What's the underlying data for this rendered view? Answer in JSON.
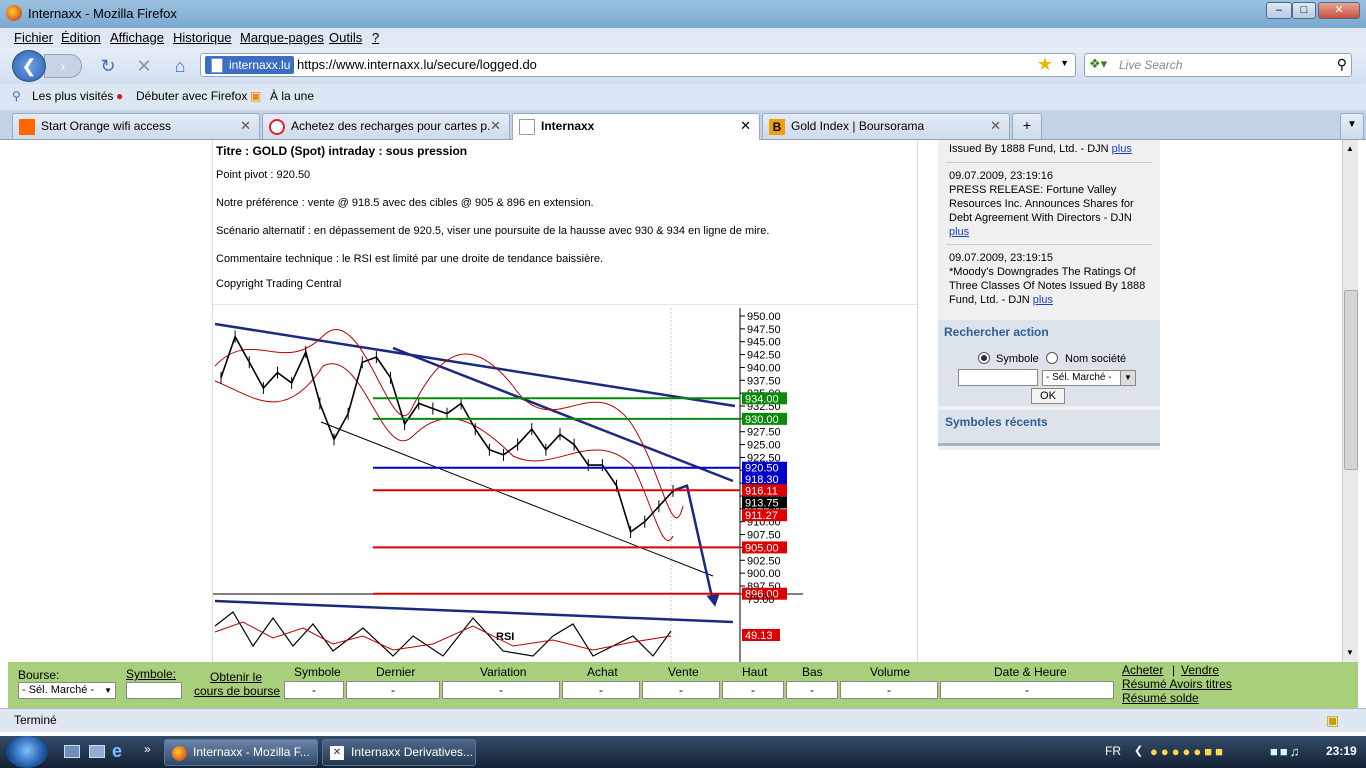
{
  "window": {
    "title": "Internaxx - Mozilla Firefox"
  },
  "menu": [
    "Fichier",
    "Édition",
    "Affichage",
    "Historique",
    "Marque-pages",
    "Outils",
    "?"
  ],
  "nav": {
    "site": "internaxx.lu",
    "url": "https://www.internaxx.lu/secure/logged.do",
    "search_placeholder": "Live Search"
  },
  "bookmarks": [
    "Les plus visités",
    "Débuter avec Firefox",
    "À la une"
  ],
  "tabs": [
    {
      "label": "Start Orange wifi access",
      "color": "#ff6600"
    },
    {
      "label": "Achetez des recharges pour cartes p...",
      "color": "#d22"
    },
    {
      "label": "Internaxx",
      "color": "#999"
    },
    {
      "label": "Gold Index | Boursorama",
      "color": "#f0a000"
    }
  ],
  "article": {
    "title": "Titre : GOLD (Spot) intraday : sous pression",
    "pivot": "Point pivot : 920.50",
    "preference": "Notre préférence : vente @ 918.5 avec des cibles @ 905 & 896 en extension.",
    "scenario": "Scénario alternatif : en dépassement de 920.5, viser une poursuite de la hausse avec 930 & 934 en ligne de mire.",
    "comment": "Commentaire technique : le RSI est limité par une droite de tendance baissière.",
    "copyright": "Copyright Trading Central"
  },
  "chart_data": {
    "type": "line",
    "title": "",
    "ylim": [
      897.5,
      950
    ],
    "y_ticks": [
      "950.00",
      "947.50",
      "945.00",
      "942.50",
      "940.00",
      "937.50",
      "935.00",
      "932.50",
      "930.00",
      "927.50",
      "925.00",
      "922.50",
      "920.00",
      "917.50",
      "915.00",
      "912.50",
      "910.00",
      "907.50",
      "905.00",
      "902.50",
      "900.00",
      "897.50"
    ],
    "levels": [
      {
        "label": "934.00",
        "value": 934.0,
        "color": "#0a8a0a"
      },
      {
        "label": "930.00",
        "value": 930.0,
        "color": "#0a8a0a"
      },
      {
        "label": "920.50",
        "value": 920.5,
        "color": "#0000cc"
      },
      {
        "label": "918.30",
        "value": 918.3,
        "color": "#0000cc"
      },
      {
        "label": "916.11",
        "value": 916.11,
        "color": "#dd0000"
      },
      {
        "label": "913.75",
        "value": 913.75,
        "color": "#000000"
      },
      {
        "label": "911.27",
        "value": 911.27,
        "color": "#dd0000"
      },
      {
        "label": "905.00",
        "value": 905.0,
        "color": "#dd0000"
      },
      {
        "label": "896.00",
        "value": 896.0,
        "color": "#dd0000"
      }
    ],
    "price": [
      938,
      946,
      941,
      936,
      939,
      937,
      943,
      933,
      926,
      931,
      941,
      942,
      938,
      929,
      933,
      932,
      931,
      933,
      928,
      924,
      923,
      925,
      928,
      924,
      927,
      925,
      921,
      921,
      917,
      908,
      910,
      913,
      916
    ],
    "rsi_label": "RSI",
    "rsi_top": "75.00",
    "rsi_value": "49.13"
  },
  "news": [
    {
      "text": "Issued By 1888 Fund, Ltd. -  DJN",
      "link": "plus"
    },
    {
      "date": "09.07.2009, 23:19:16",
      "text": "PRESS RELEASE: Fortune Valley Resources Inc. Announces Shares for Debt Agreement With Directors -  DJN",
      "link": "plus"
    },
    {
      "date": "09.07.2009, 23:19:15",
      "text": "*Moody's Downgrades The Ratings Of Three Classes Of Notes Issued By 1888 Fund, Ltd. -  DJN",
      "link": "plus"
    }
  ],
  "search_action": {
    "title": "Rechercher action",
    "opt1": "Symbole",
    "opt2": "Nom société",
    "market": "- Sél. Marché -",
    "ok": "OK"
  },
  "recent": {
    "title": "Symboles récents"
  },
  "quote_bar": {
    "bourse_label": "Bourse:",
    "bourse_value": "- Sél. Marché -",
    "symbole_label": "Symbole:",
    "obtain1": "Obtenir le",
    "obtain2": "cours de bourse",
    "columns": [
      "Symbole",
      "Dernier",
      "Variation",
      "Achat",
      "Vente",
      "Haut",
      "Bas",
      "Volume",
      "Date & Heure"
    ],
    "dash": "-",
    "acheter": "Acheter",
    "sep": "|",
    "vendre": "Vendre",
    "resume_titres": "Résumé Avoirs titres",
    "resume_solde": "Résumé solde"
  },
  "status": "Terminé",
  "taskbar": {
    "items": [
      "Internaxx - Mozilla F...",
      "Internaxx Derivatives..."
    ],
    "lang": "FR",
    "time": "23:19"
  }
}
